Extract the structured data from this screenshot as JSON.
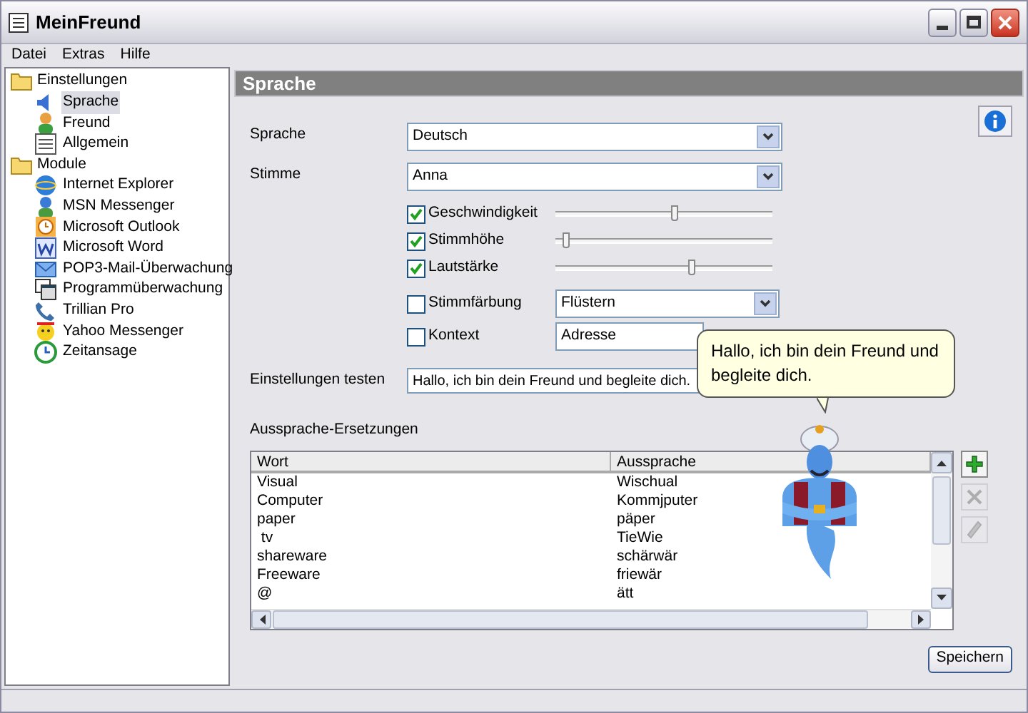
{
  "window": {
    "title": "MeinFreund"
  },
  "menu": [
    "Datei",
    "Extras",
    "Hilfe"
  ],
  "tree": [
    {
      "label": "Einstellungen",
      "selected": false,
      "children": [
        {
          "label": "Sprache",
          "selected": true
        },
        {
          "label": "Freund",
          "selected": false
        },
        {
          "label": "Allgemein",
          "selected": false
        }
      ]
    },
    {
      "label": "Module",
      "selected": false,
      "children": [
        {
          "label": "Internet Explorer",
          "selected": false
        },
        {
          "label": "MSN Messenger",
          "selected": false
        },
        {
          "label": "Microsoft Outlook",
          "selected": false
        },
        {
          "label": "Microsoft Word",
          "selected": false
        },
        {
          "label": "POP3-Mail-Überwachung",
          "selected": false
        },
        {
          "label": "Programmüberwachung",
          "selected": false
        },
        {
          "label": "Trillian Pro",
          "selected": false
        },
        {
          "label": "Yahoo Messenger",
          "selected": false
        },
        {
          "label": "Zeitansage",
          "selected": false
        }
      ]
    }
  ],
  "panel": {
    "title": "Sprache"
  },
  "fields": [
    {
      "label": "Sprache",
      "value": "Deutsch"
    },
    {
      "label": "Stimme",
      "value": "Anna"
    }
  ],
  "sliders": [
    {
      "label": "Geschwindigkeit",
      "checked": true,
      "level": 0.55
    },
    {
      "label": "Stimmhöhe",
      "checked": true,
      "level": 0.05
    },
    {
      "label": "Lautstärke",
      "checked": true,
      "level": 0.63
    }
  ],
  "options": [
    {
      "label": "Stimmfärbung",
      "checked": false,
      "value": "Flüstern"
    },
    {
      "label": "Kontext",
      "checked": false,
      "value": "Adresse"
    }
  ],
  "test": {
    "label": "Einstellungen testen",
    "value": "Hallo, ich bin dein Freund und begleite dich."
  },
  "replacements": {
    "title": "Aussprache-Ersetzungen",
    "columns": [
      "Wort",
      "Aussprache"
    ],
    "rows": [
      [
        "Visual",
        "Wischual"
      ],
      [
        "Computer",
        "Kommjputer"
      ],
      [
        "paper",
        "päper"
      ],
      [
        " tv",
        "TieWie"
      ],
      [
        "shareware",
        "schärwär"
      ],
      [
        "Freeware",
        "friewär"
      ],
      [
        "@",
        "ätt"
      ]
    ]
  },
  "side_buttons": [
    {
      "disabled": false
    },
    {
      "disabled": true
    },
    {
      "disabled": true
    }
  ],
  "balloon": {
    "text": "Hallo, ich bin dein Freund und begleite dich."
  },
  "save_button": "Speichern"
}
